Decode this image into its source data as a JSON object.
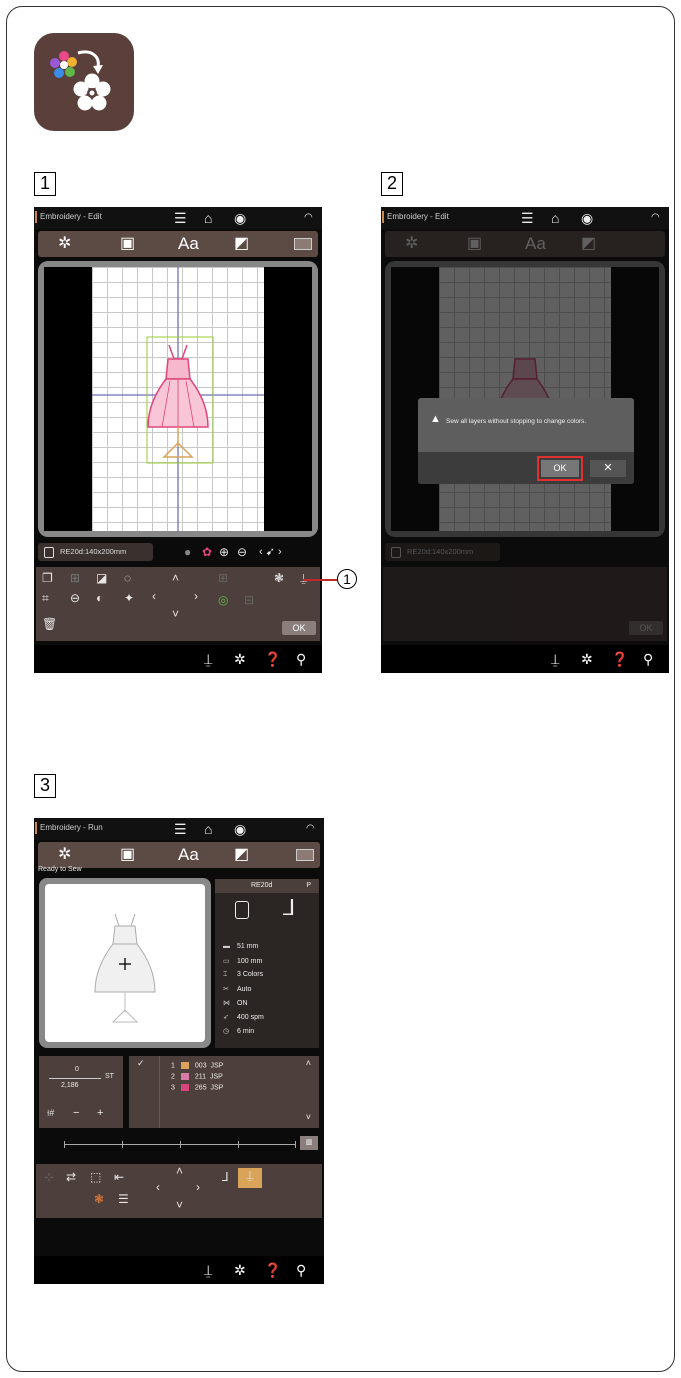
{
  "steps": {
    "s1": "1",
    "s2": "2",
    "s3": "3"
  },
  "callout": {
    "label": "1"
  },
  "screen1": {
    "title": "Embroidery - Edit",
    "tabs": {
      "aa": "Aa"
    },
    "size_chip": "RE20d:140x200mm",
    "ok_label": "OK"
  },
  "screen2": {
    "title": "Embroidery - Edit",
    "tabs": {
      "aa": "Aa"
    },
    "size_chip": "RE20d:140x200mm",
    "dialog_message": "Sew all layers without stopping to change colors.",
    "dialog_ok": "OK",
    "dialog_cancel": "✕",
    "ok_label": "OK"
  },
  "screen3": {
    "title": "Embroidery - Run",
    "tabs": {
      "aa": "Aa"
    },
    "status": "Ready to Sew",
    "hoop": "RE20d",
    "foot": "P",
    "info": {
      "height": "51 mm",
      "width": "100 mm",
      "colors": "3 Colors",
      "cutter": "Auto",
      "thread_sensor": "ON",
      "speed": "400 spm",
      "time": "6 min"
    },
    "stitch": {
      "current": "0",
      "total": "2,186",
      "unit": "ST"
    },
    "color_list": [
      {
        "num": "1",
        "code": "003",
        "brand": "JSP",
        "color": "#d9a35a"
      },
      {
        "num": "2",
        "code": "211",
        "brand": "JSP",
        "color": "#d97aa8"
      },
      {
        "num": "3",
        "code": "265",
        "brand": "JSP",
        "color": "#d9457a"
      }
    ],
    "counter_minus": "−",
    "counter_plus": "+"
  },
  "colors": {
    "brown_panel": "#4d3f3b",
    "ok_highlight": "#e03030",
    "dress_pink": "#e0457a"
  }
}
